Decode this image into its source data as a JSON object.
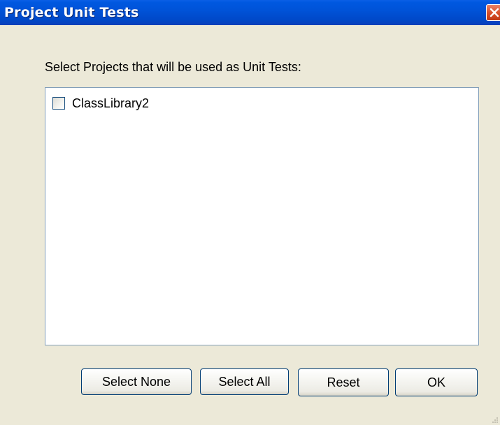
{
  "window": {
    "title": "Project Unit Tests",
    "close_icon": "close-icon"
  },
  "prompt": "Select Projects that will be used as Unit Tests:",
  "projects": [
    {
      "label": "ClassLibrary2",
      "checked": false
    }
  ],
  "buttons": {
    "select_none": "Select None",
    "select_all": "Select All",
    "reset": "Reset",
    "ok": "OK"
  },
  "colors": {
    "titlebar": "#0053d8",
    "dialog_bg": "#ece9d8",
    "close_button": "#d9512c"
  }
}
